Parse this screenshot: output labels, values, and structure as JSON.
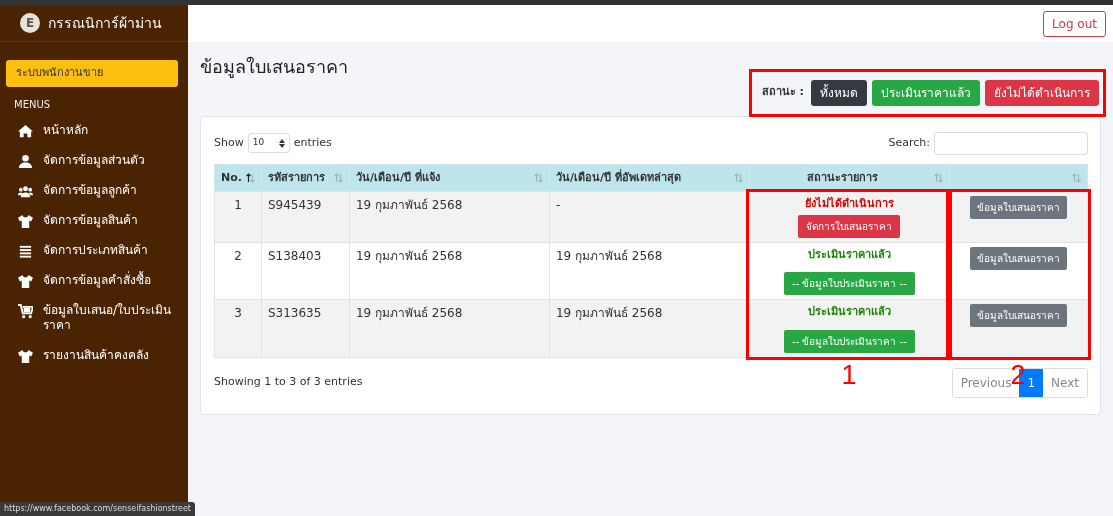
{
  "sidebar": {
    "brand": {
      "logo_letter": "E",
      "title": "กรรณนิการ์ผ้าม่าน"
    },
    "role_button": {
      "label": "ระบบพนักงานขาย",
      "selected": true
    },
    "section_label": "MENUS",
    "items": [
      {
        "label": "หน้าหลัก",
        "selected": false
      },
      {
        "label": "จัดการข้อมูลส่วนตัว",
        "selected": false
      },
      {
        "label": "จัดการข้อมูลลูกค้า",
        "selected": false
      },
      {
        "label": "จัดการข้อมูลสินค้า",
        "selected": false
      },
      {
        "label": "จัดการประเภทสินค้า",
        "selected": false
      },
      {
        "label": "จัดการข้อมูลคำสั่งซื้อ",
        "selected": false
      },
      {
        "label": "ข้อมูลใบเสนอ/ใบประเมินราคา",
        "selected": false
      },
      {
        "label": "รายงานสินค้าคงคลัง",
        "selected": false
      }
    ]
  },
  "topbar": {
    "logout": "Log out"
  },
  "page_title": "ข้อมูลใบเสนอราคา",
  "status_filter": {
    "label": "สถานะ :",
    "buttons": [
      {
        "label": "ทั้งหมด",
        "kind": "dark"
      },
      {
        "label": "ประเมินราคาแล้ว",
        "kind": "success"
      },
      {
        "label": "ยังไม่ได้ดำเนินการ",
        "kind": "danger"
      }
    ]
  },
  "table_controls": {
    "show_label": "Show",
    "page_size": "10",
    "entries_label": "entries",
    "search_label": "Search:"
  },
  "table": {
    "columns": [
      {
        "label": "No.",
        "sorted": true
      },
      {
        "label": "รหัสรายการ",
        "sorted": false
      },
      {
        "label": "วัน/เดือน/ปี ที่แจ้ง",
        "sorted": false
      },
      {
        "label": "วัน/เดือน/ปี ที่อัพเดทล่าสุด",
        "sorted": false
      },
      {
        "label": "สถานะรายการ",
        "sorted": false
      },
      {
        "sorted": false
      }
    ],
    "rows": [
      {
        "no": "1",
        "code": "S945439",
        "reported": "19 กุมภาพันธ์ 2568",
        "updated": "-",
        "status": "ยังไม่ได้ดำเนินการ",
        "evaluated": false,
        "status_button": "จัดการใบเสนอราคา",
        "action": "ข้อมูลใบเสนอราคา"
      },
      {
        "no": "2",
        "code": "S138403",
        "reported": "19 กุมภาพันธ์ 2568",
        "updated": "19 กุมภาพันธ์ 2568",
        "status": "ประเมินราคาแล้ว",
        "evaluated": true,
        "status_button": "-- ข้อมูลใบประเมินราคา --",
        "action": "ข้อมูลใบเสนอราคา"
      },
      {
        "no": "3",
        "code": "S313635",
        "reported": "19 กุมภาพันธ์ 2568",
        "updated": "19 กุมภาพันธ์ 2568",
        "status": "ประเมินราคาแล้ว",
        "evaluated": true,
        "status_button": "-- ข้อมูลใบประเมินราคา --",
        "action": "ข้อมูลใบเสนอราคา"
      }
    ]
  },
  "table_info": "Showing 1 to 3 of 3 entries",
  "pagination": [
    {
      "label": "Previous",
      "selected": false
    },
    {
      "label": "1",
      "selected": true
    },
    {
      "label": "Next",
      "selected": false
    }
  ],
  "annotations": [
    {
      "kind": "box"
    },
    {
      "kind": "box",
      "label": "1"
    },
    {
      "kind": "box",
      "label": "2"
    }
  ],
  "status_bar_link": "https://www.facebook.com/senseifashionstreet"
}
